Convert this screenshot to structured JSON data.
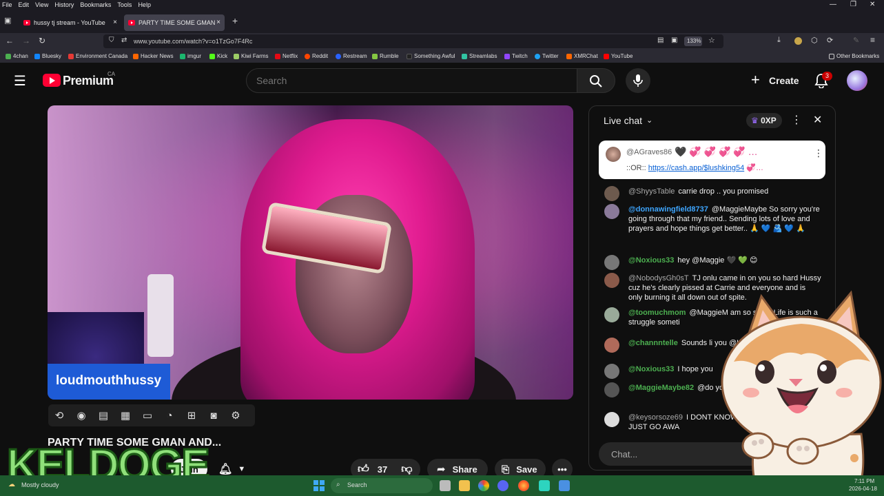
{
  "menubar": {
    "items": [
      "File",
      "Edit",
      "View",
      "History",
      "Bookmarks",
      "Tools",
      "Help"
    ]
  },
  "tabs": [
    {
      "label": "hussy tj stream - YouTube",
      "close": "×"
    },
    {
      "label": "PARTY TIME SOME GMAN AND...",
      "close": "×"
    }
  ],
  "newtab": "+",
  "nav": {
    "url": "www.youtube.com/watch?v=o1TzGo7F4Rc",
    "zoom": "133%"
  },
  "bookmarks": [
    {
      "label": "4chan",
      "color": "#4caf50"
    },
    {
      "label": "Bluesky",
      "color": "#1185fe"
    },
    {
      "label": "Environment Canada",
      "color": "#e53935"
    },
    {
      "label": "Hacker News",
      "color": "#ff6600"
    },
    {
      "label": "imgur",
      "color": "#1bb76e"
    },
    {
      "label": "Kick",
      "color": "#53fc18"
    },
    {
      "label": "Kiwi Farms",
      "color": "#9ccc65"
    },
    {
      "label": "Netflix",
      "color": "#e50914"
    },
    {
      "label": "Reddit",
      "color": "#ff4500"
    },
    {
      "label": "Restream",
      "color": "#2962ff"
    },
    {
      "label": "Rumble",
      "color": "#85c742"
    },
    {
      "label": "Something Awful",
      "color": "#222222"
    },
    {
      "label": "Streamlabs",
      "color": "#31c3a2"
    },
    {
      "label": "Twitch",
      "color": "#9146ff"
    },
    {
      "label": "Twitter",
      "color": "#1da1f2"
    },
    {
      "label": "XMRChat",
      "color": "#ff6600"
    },
    {
      "label": "YouTube",
      "color": "#ff0000"
    }
  ],
  "other_bookmarks": "Other Bookmarks",
  "yt": {
    "brand": "Premium",
    "region": "CA",
    "search_placeholder": "Search",
    "create_label": "Create",
    "notif_count": "3"
  },
  "video": {
    "channel_overlay": "loudmouthhussy",
    "title": "PARTY TIME SOME GMAN AND...",
    "join_label": "Join",
    "likes": "37",
    "share_label": "Share",
    "save_label": "Save"
  },
  "chat": {
    "title": "Live chat",
    "xp": "0XP",
    "pinned": {
      "author": "@AGraves86",
      "line2_prefix": "::OR:: ",
      "link": "https://cash.app/$lushking54"
    },
    "messages": [
      {
        "author": "@ShyysTable",
        "text": "carrie drop .. you promised",
        "author_style": "grey",
        "avatar": "#6d5a4e"
      },
      {
        "author": "@donnawingfield8737",
        "text": "@MaggieMaybe So sorry you're going through that my friend.. Sending lots of love and prayers and hope things get better.. 🙏 💙 🫂 💙 🙏",
        "author_style": "blue",
        "avatar": "#8a7a9a"
      },
      {
        "author": "@Noxious33",
        "text": "hey @Maggie 🖤 💚 😊",
        "author_style": "green",
        "avatar": "#777777"
      },
      {
        "author": "@NobodysGh0sT",
        "text": "TJ onlu came in on you so hard Hussy cuz he's clearly pissed at Carrie and everyone and is only burning it all down out of spite.",
        "author_style": "grey",
        "avatar": "#8a5a4a"
      },
      {
        "author": "@toomuchmom",
        "text": "@MaggieM am so sorry. Life is such a struggle someti",
        "author_style": "green",
        "avatar": "#99aa99"
      },
      {
        "author": "@channntelle",
        "text": "Sounds li you @Leahdc713 i admire",
        "author_style": "green",
        "avatar": "#b06a5a"
      },
      {
        "author": "@Noxious33",
        "text": "I hope you",
        "author_style": "green",
        "avatar": "#777777"
      },
      {
        "author": "@MaggieMaybe82",
        "text": "@do you sweetie! It'll get better",
        "author_style": "green",
        "avatar": "#555555"
      },
      {
        "author": "@keysorsoze69",
        "text": "I DONT KNOW WE ARE GROWN, JUST GO AWA",
        "author_style": "grey",
        "avatar": "#dddddd"
      }
    ],
    "input_placeholder": "Chat..."
  },
  "overlay": {
    "keldoge": "KELDOGE"
  },
  "taskbar": {
    "weather": "Mostly cloudy",
    "search": "Search",
    "time": "7:11 PM",
    "date": "2026-04-18"
  }
}
